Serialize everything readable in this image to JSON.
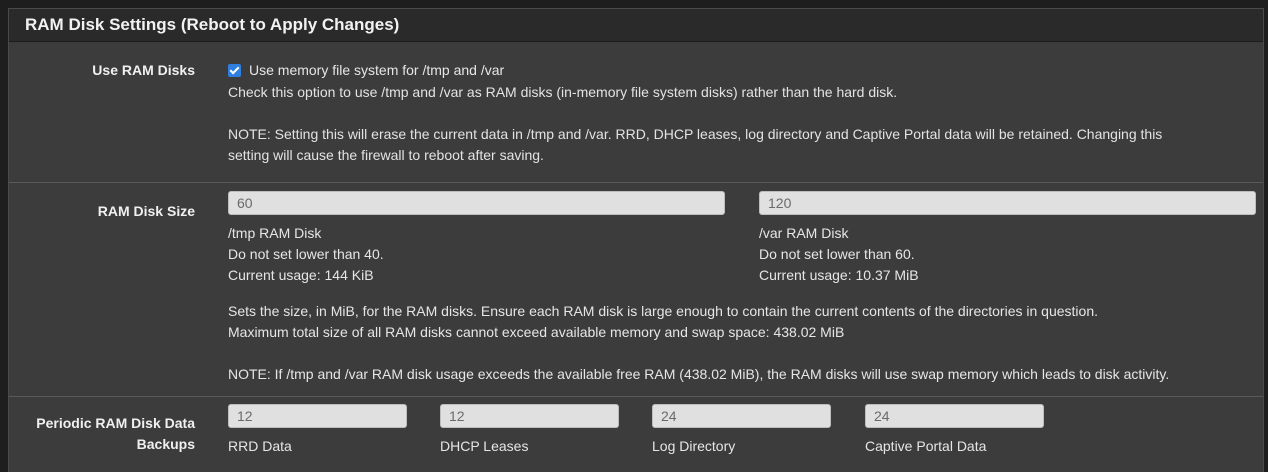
{
  "panel": {
    "title": "RAM Disk Settings (Reboot to Apply Changes)"
  },
  "use_ram_disks": {
    "label": "Use RAM Disks",
    "checked": true,
    "checkbox_label": "Use memory file system for /tmp and /var",
    "help1": "Check this option to use /tmp and /var as RAM disks (in-memory file system disks) rather than the hard disk.",
    "note_line1": "NOTE: Setting this will erase the current data in /tmp and /var. RRD, DHCP leases, log directory and Captive Portal data will be retained. Changing this",
    "note_line2": "setting will cause the firewall to reboot after saving."
  },
  "ram_disk_size": {
    "label": "RAM Disk Size",
    "tmp": {
      "value": "60",
      "name": "/tmp RAM Disk",
      "min": "Do not set lower than 40.",
      "usage": "Current usage: 144 KiB"
    },
    "var": {
      "value": "120",
      "name": "/var RAM Disk",
      "min": "Do not set lower than 60.",
      "usage": "Current usage: 10.37 MiB"
    },
    "help_line1": "Sets the size, in MiB, for the RAM disks. Ensure each RAM disk is large enough to contain the current contents of the directories in question.",
    "help_line2": "Maximum total size of all RAM disks cannot exceed available memory and swap space: 438.02 MiB",
    "note": "NOTE: If /tmp and /var RAM disk usage exceeds the available free RAM (438.02 MiB), the RAM disks will use swap memory which leads to disk activity."
  },
  "backups": {
    "label_line1": "Periodic RAM Disk Data",
    "label_line2": "Backups",
    "fields": [
      {
        "value": "12",
        "name": "RRD Data"
      },
      {
        "value": "12",
        "name": "DHCP Leases"
      },
      {
        "value": "24",
        "name": "Log Directory"
      },
      {
        "value": "24",
        "name": "Captive Portal Data"
      }
    ]
  }
}
